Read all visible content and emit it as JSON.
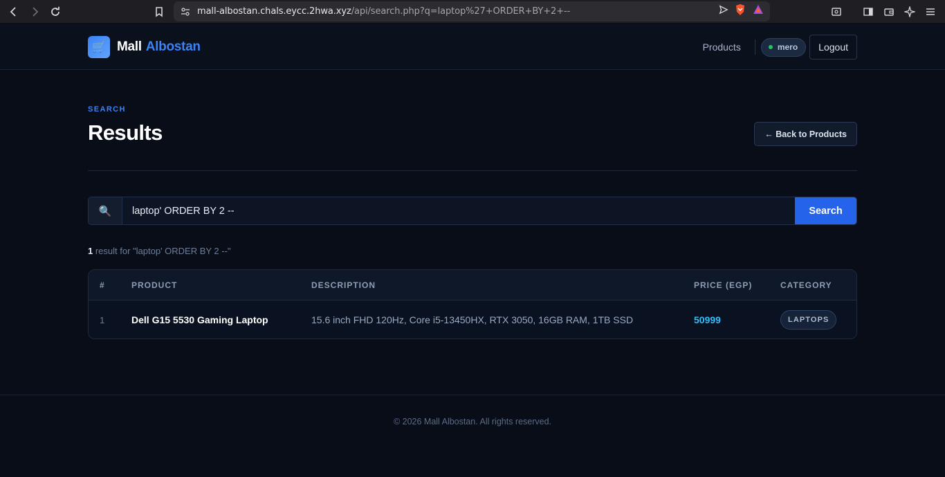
{
  "browser": {
    "url_host": "mall-albostan.chals.eycc.2hwa.xyz",
    "url_path": "/api/search.php?q=laptop%27+ORDER+BY+2+--"
  },
  "header": {
    "logo_icon": "🛒",
    "logo_word1": "Mall",
    "logo_word2": "Albostan",
    "nav_products": "Products",
    "username": "mero",
    "logout": "Logout"
  },
  "page": {
    "eyebrow": "SEARCH",
    "title": "Results",
    "back_button": "← Back to Products"
  },
  "search": {
    "icon": "🔍",
    "value": "laptop' ORDER BY 2 --",
    "button": "Search"
  },
  "results": {
    "count": "1",
    "summary": " result for \"laptop' ORDER BY 2 --\"",
    "columns": [
      "#",
      "PRODUCT",
      "DESCRIPTION",
      "PRICE (EGP)",
      "CATEGORY"
    ],
    "rows": [
      {
        "index": "1",
        "product": "Dell G15 5530 Gaming Laptop",
        "description": "15.6 inch FHD 120Hz, Core i5-13450HX, RTX 3050, 16GB RAM, 1TB SSD",
        "price": "50999",
        "category": "LAPTOPS"
      }
    ]
  },
  "footer": {
    "text": "© 2026 Mall Albostan. All rights reserved."
  },
  "colors": {
    "accent": "#3b82f6",
    "search_button": "#2563eb",
    "price": "#38bdf8",
    "background": "#080d18"
  }
}
